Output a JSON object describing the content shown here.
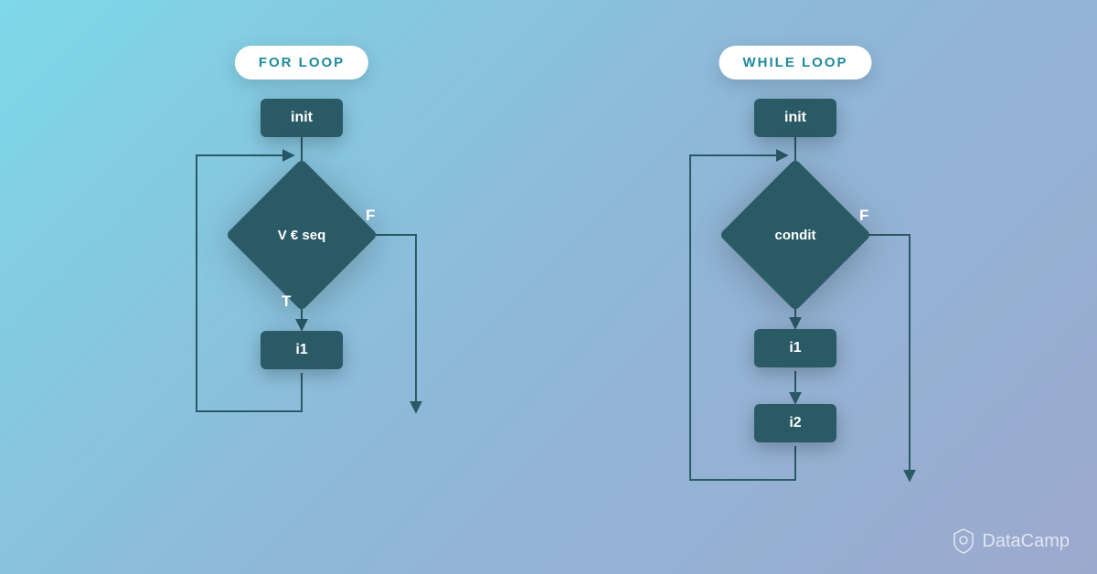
{
  "for_loop": {
    "title": "FOR LOOP",
    "init": "init",
    "condition": "V € seq",
    "true_label": "T",
    "false_label": "F",
    "step1": "i1"
  },
  "while_loop": {
    "title": "WHILE LOOP",
    "init": "init",
    "condition": "condit",
    "false_label": "F",
    "step1": "i1",
    "step2": "i2"
  },
  "brand": "DataCamp",
  "colors": {
    "box": "#2a5a65",
    "line": "#2a5a65",
    "accent": "#1e8a9b"
  }
}
